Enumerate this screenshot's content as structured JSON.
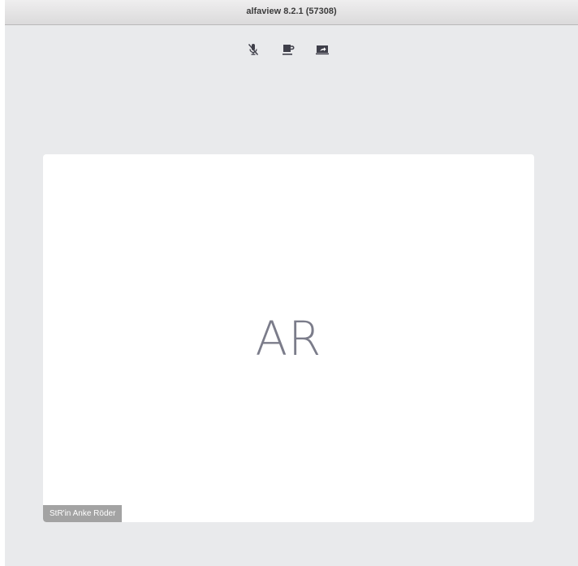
{
  "window": {
    "title": "alfaview 8.2.1 (57308)"
  },
  "toolbar": {
    "items": [
      {
        "icon": "microphone-muted-icon",
        "label": ""
      },
      {
        "icon": "coffee-break-icon",
        "label": ""
      },
      {
        "icon": "screen-share-icon",
        "label": ""
      }
    ],
    "icon_color": "#3f3f4a"
  },
  "participant": {
    "initials": "AR",
    "name": "StR'in Anke Röder",
    "initials_color": "#7b7c8a",
    "badge_color": "#a3a3a3"
  }
}
